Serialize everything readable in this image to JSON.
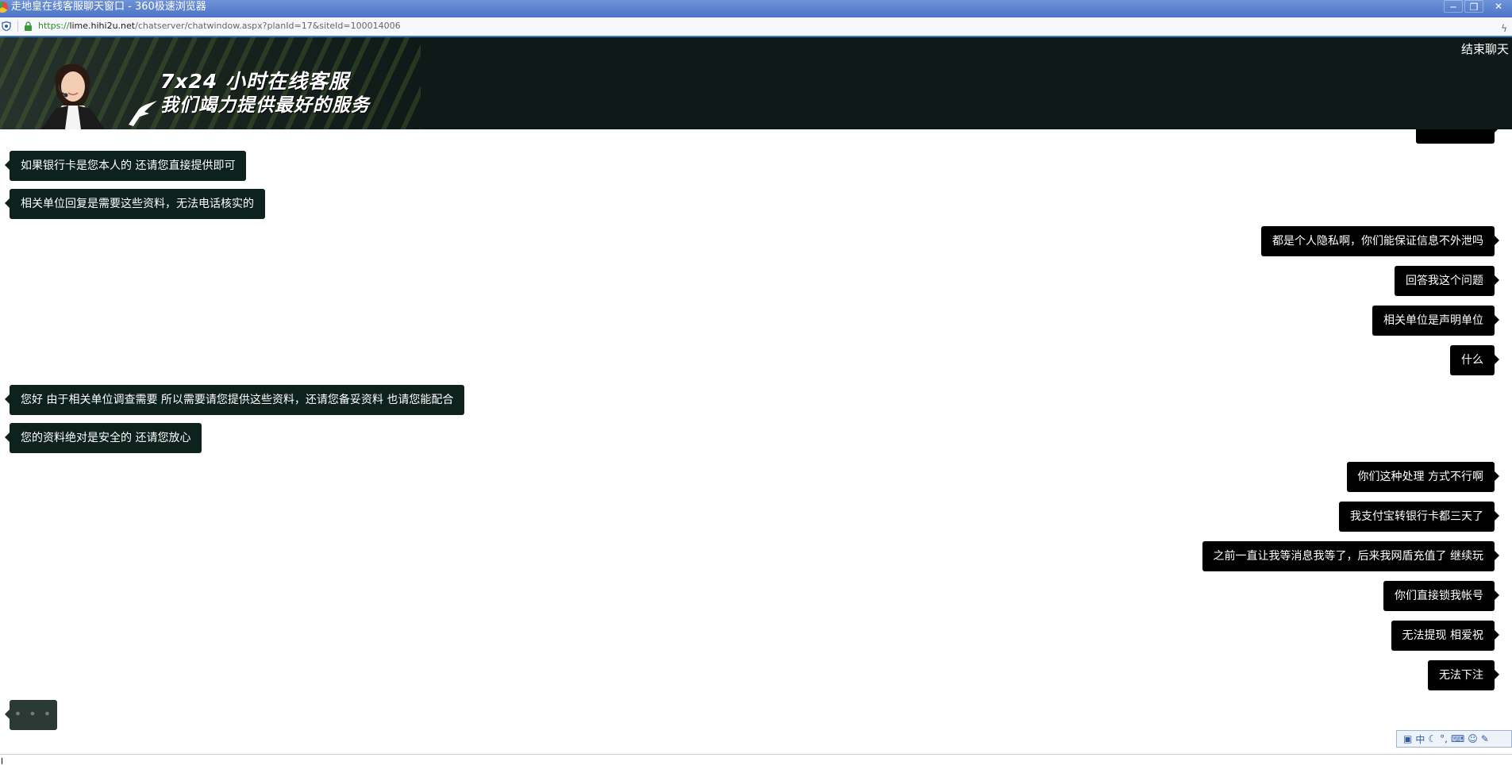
{
  "window": {
    "title": "走地皇在线客服聊天窗口 - 360极速浏览器",
    "controls": [
      "─",
      "❐",
      "✕"
    ]
  },
  "address_bar": {
    "url_scheme": "https://",
    "url_host": "lime.hihi2u.net",
    "url_path": "/chatserver/chatwindow.aspx?planId=17&siteId=100014006"
  },
  "banner": {
    "headline": "7x24 小时在线客服",
    "subline": "我们竭力提供最好的服务",
    "end_chat_label": "结束聊天",
    "background_color": "#0f1a18"
  },
  "messages": [
    {
      "side": "left",
      "text": "如果银行卡是您本人的 还请您直接提供即可"
    },
    {
      "side": "left",
      "text": "相关单位回复是需要这些资料，无法电话核实的"
    },
    {
      "side": "right",
      "text": "都是个人隐私啊，你们能保证信息不外泄吗"
    },
    {
      "side": "right",
      "text": "回答我这个问题"
    },
    {
      "side": "right",
      "text": "相关单位是声明单位"
    },
    {
      "side": "right",
      "text": "什么"
    },
    {
      "side": "left",
      "text": "您好 由于相关单位调查需要 所以需要请您提供这些资料，还请您备妥资料 也请您能配合"
    },
    {
      "side": "left",
      "text": "您的资料绝对是安全的 还请您放心"
    },
    {
      "side": "right",
      "text": "你们这种处理 方式不行啊"
    },
    {
      "side": "right",
      "text": "我支付宝转银行卡都三天了"
    },
    {
      "side": "right",
      "text": "之前一直让我等消息我等了，后来我网盾充值了 继续玩"
    },
    {
      "side": "right",
      "text": "你们直接锁我帐号"
    },
    {
      "side": "right",
      "text": "无法提现 相爱祝"
    },
    {
      "side": "right",
      "text": "无法下注"
    }
  ],
  "typing_indicator": "• • •",
  "ime_toolbar": {
    "mode_label": "中"
  },
  "colors": {
    "agent_bubble": "#0d211d",
    "user_bubble": "#000000",
    "titlebar": "#4c74c7"
  }
}
